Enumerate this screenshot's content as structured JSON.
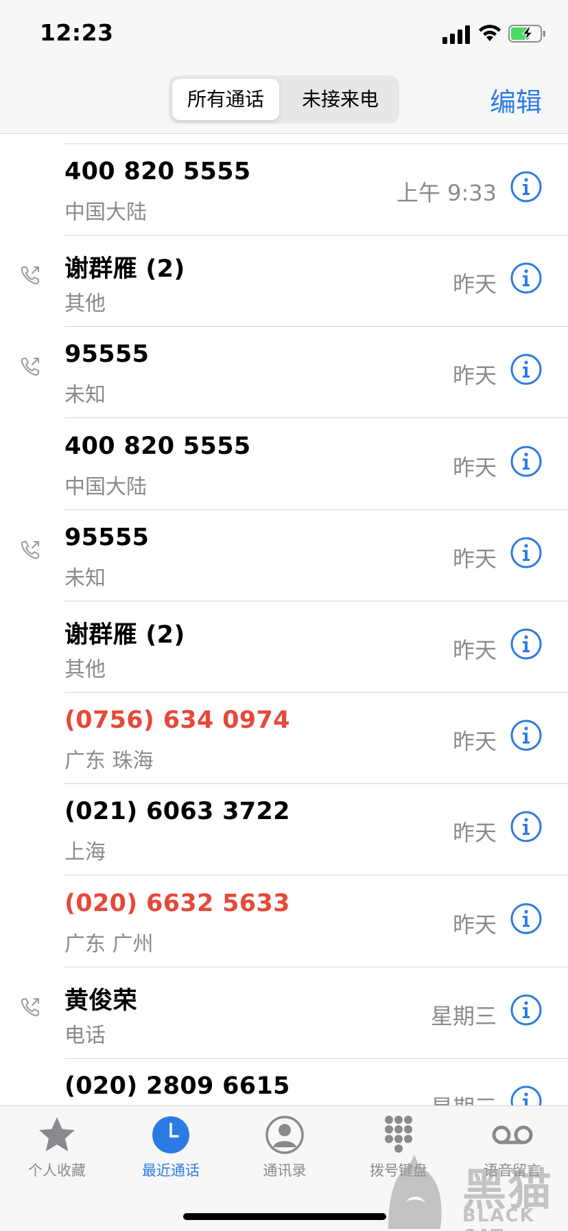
{
  "status_bar": {
    "time": "12:23"
  },
  "nav": {
    "segments": [
      "所有通话",
      "未接来电"
    ],
    "selected_segment": "所有通话",
    "edit_label": "编辑"
  },
  "colors": {
    "accent": "#2c7be5",
    "missed": "#e5493a",
    "secondary_text": "#8a8a8e",
    "battery_charge": "#4cd964"
  },
  "calls": [
    {
      "name": "400 820 5555",
      "subtitle": "中国大陆",
      "time": "上午 9:33",
      "outgoing": false,
      "missed": false
    },
    {
      "name": "谢群雁 (2)",
      "subtitle": "其他",
      "time": "昨天",
      "outgoing": true,
      "missed": false
    },
    {
      "name": "95555",
      "subtitle": "未知",
      "time": "昨天",
      "outgoing": true,
      "missed": false
    },
    {
      "name": "400 820 5555",
      "subtitle": "中国大陆",
      "time": "昨天",
      "outgoing": false,
      "missed": false
    },
    {
      "name": "95555",
      "subtitle": "未知",
      "time": "昨天",
      "outgoing": true,
      "missed": false
    },
    {
      "name": "谢群雁 (2)",
      "subtitle": "其他",
      "time": "昨天",
      "outgoing": false,
      "missed": false
    },
    {
      "name": "(0756) 634 0974",
      "subtitle": "广东 珠海",
      "time": "昨天",
      "outgoing": false,
      "missed": true
    },
    {
      "name": "(021) 6063 3722",
      "subtitle": "上海",
      "time": "昨天",
      "outgoing": false,
      "missed": false
    },
    {
      "name": "(020) 6632 5633",
      "subtitle": "广东 广州",
      "time": "昨天",
      "outgoing": false,
      "missed": true
    },
    {
      "name": "黄俊荣",
      "subtitle": "电话",
      "time": "星期三",
      "outgoing": true,
      "missed": false
    },
    {
      "name": "(020) 2809 6615",
      "subtitle": "",
      "time": "星期三",
      "outgoing": false,
      "missed": false
    }
  ],
  "tab_bar": {
    "tabs": [
      {
        "label": "个人收藏",
        "icon": "star-icon"
      },
      {
        "label": "最近通话",
        "icon": "clock-icon"
      },
      {
        "label": "通讯录",
        "icon": "person-circle-icon"
      },
      {
        "label": "拨号键盘",
        "icon": "keypad-icon"
      },
      {
        "label": "语音留言",
        "icon": "voicemail-icon"
      }
    ],
    "active_tab": "最近通话"
  },
  "watermark": {
    "title": "黑猫",
    "subtitle": "BLACK CAT"
  }
}
